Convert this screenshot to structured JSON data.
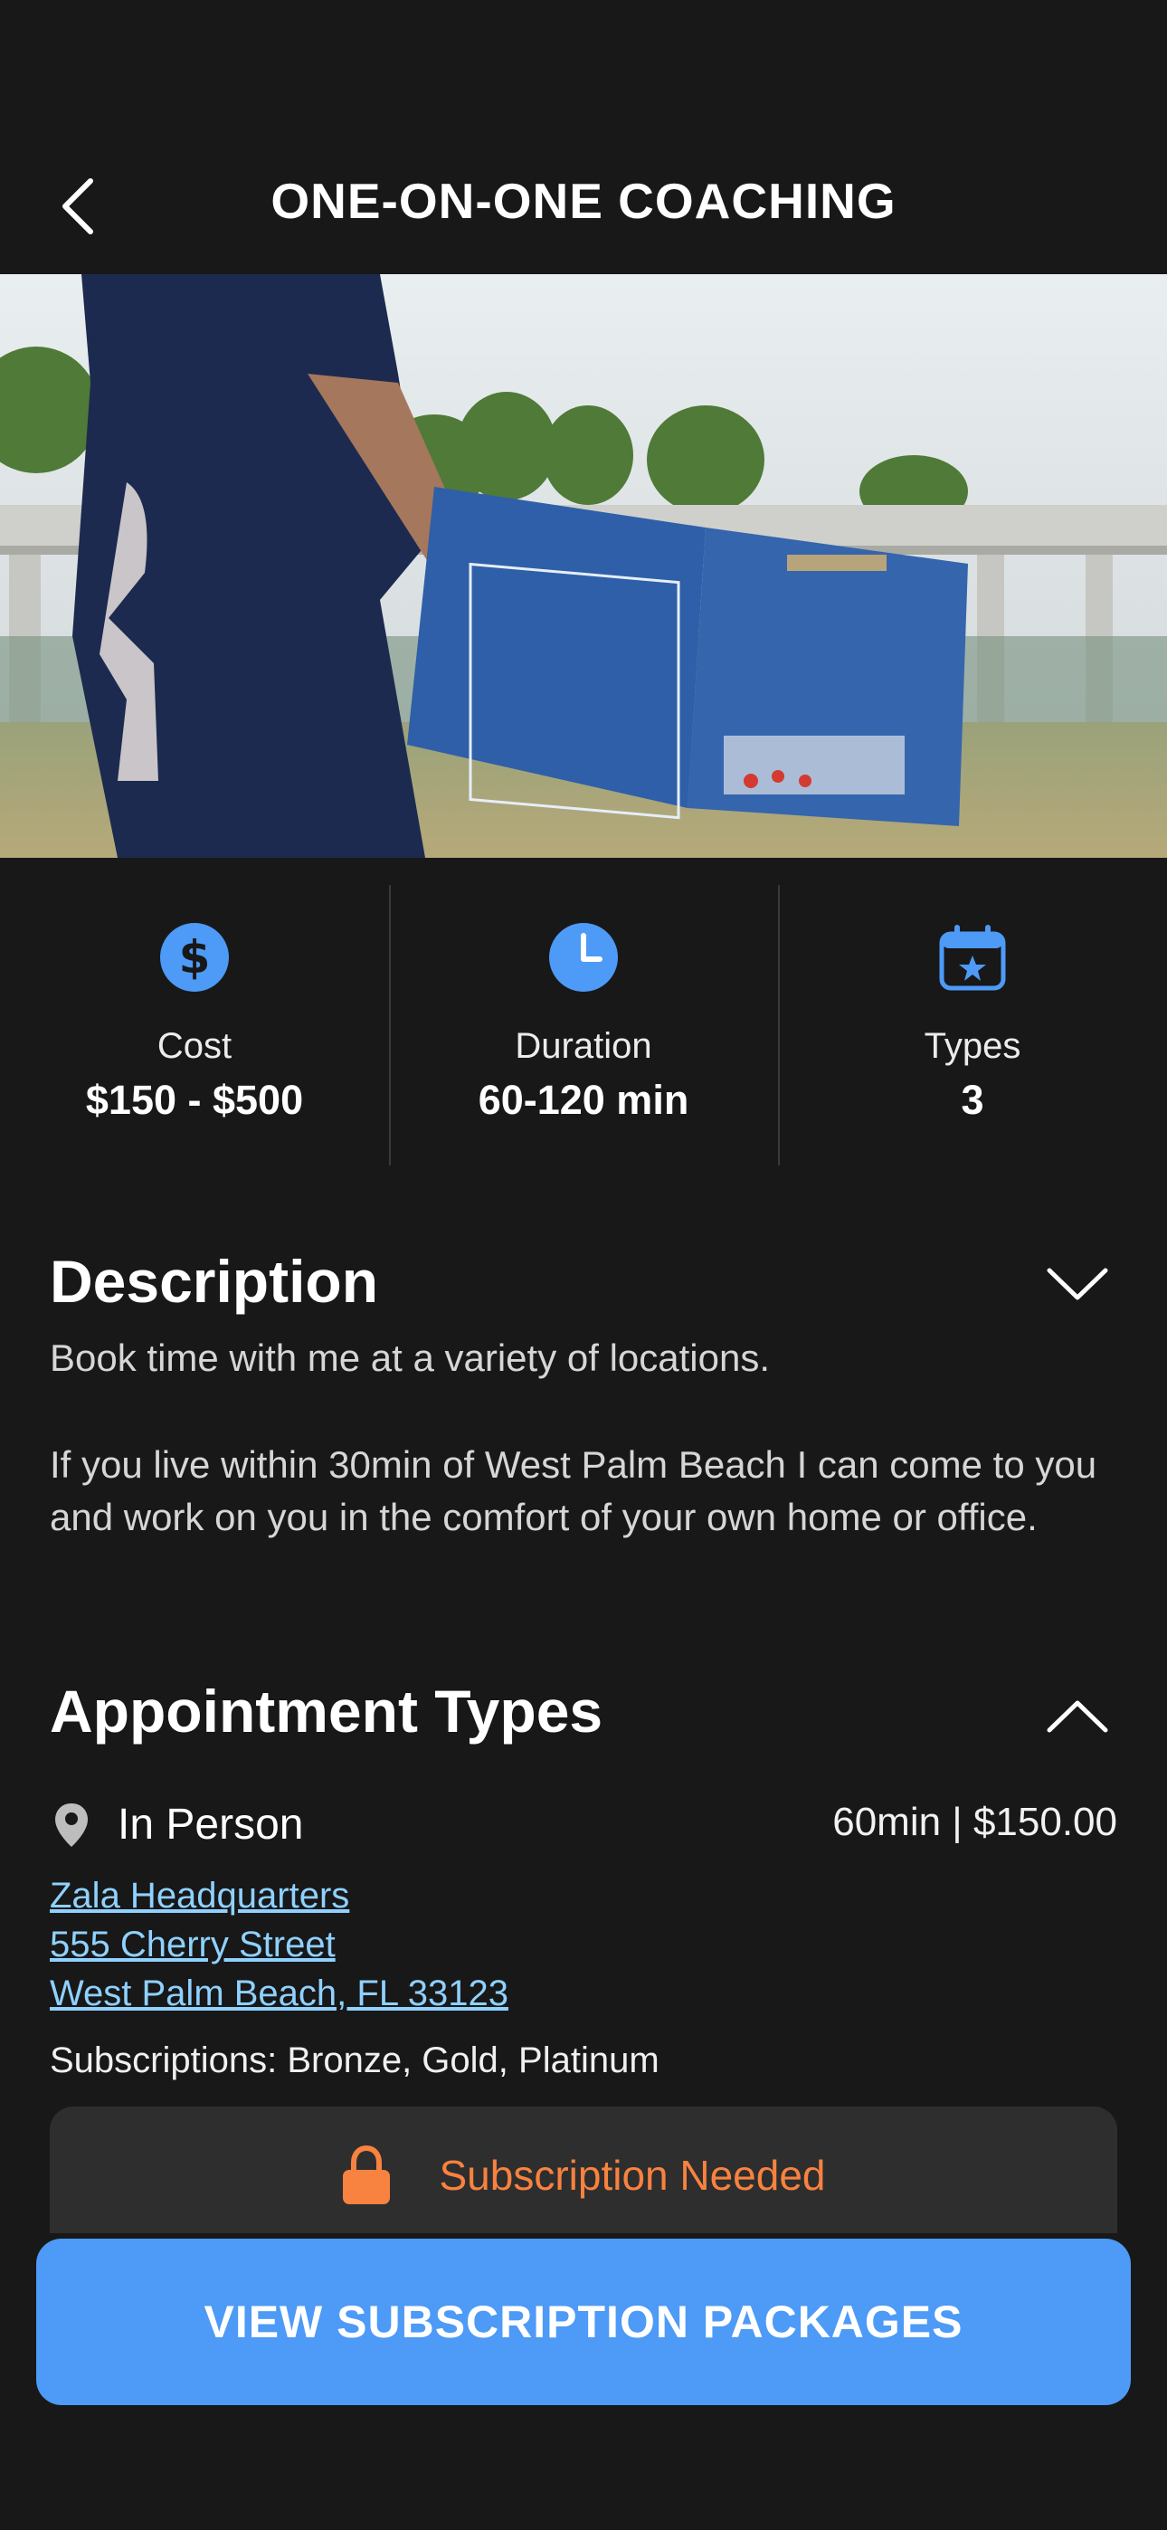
{
  "header": {
    "title": "ONE-ON-ONE COACHING"
  },
  "stats": [
    {
      "icon": "dollar-icon",
      "label": "Cost",
      "value": "$150 - $500"
    },
    {
      "icon": "clock-icon",
      "label": "Duration",
      "value": "60-120 min"
    },
    {
      "icon": "calendar-star-icon",
      "label": "Types",
      "value": "3"
    }
  ],
  "description": {
    "title": "Description",
    "paragraph1": "Book time with me at a variety of locations.",
    "paragraph2": "If you live within 30min of West Palm Beach I can come to you and work on you in the comfort of your own home or office."
  },
  "appointment_types": {
    "title": "Appointment Types",
    "items": [
      {
        "icon": "location-pin-icon",
        "name": "In Person",
        "price": "60min | $150.00",
        "address": [
          "Zala Headquarters",
          "555 Cherry Street",
          "West Palm Beach, FL 33123"
        ],
        "subscriptions": "Subscriptions: Bronze, Gold, Platinum",
        "notice": "Subscription Needed"
      }
    ]
  },
  "cta": {
    "label": "VIEW SUBSCRIPTION PACKAGES"
  },
  "colors": {
    "accent": "#4d9af7",
    "warning": "#f8823f",
    "link": "#8fd1ff",
    "background": "#181818"
  }
}
